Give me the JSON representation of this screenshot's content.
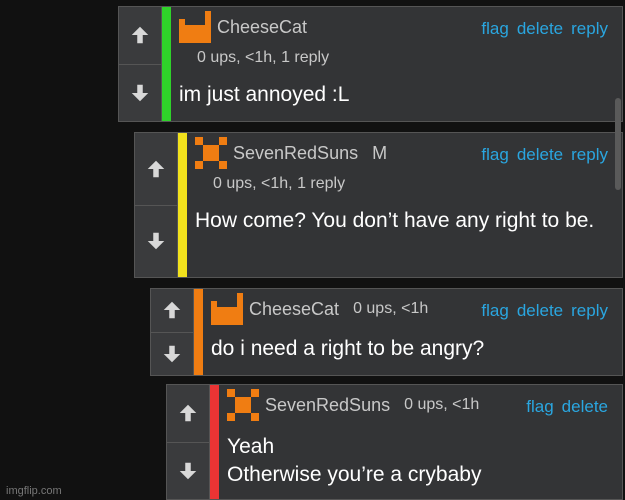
{
  "colors": {
    "green": "#2fd32a",
    "yellow": "#f2e21d",
    "orange": "#f07d12",
    "red": "#ea3434",
    "link": "#2aa6e0"
  },
  "comments": [
    {
      "username": "CheeseCat",
      "meta": "0 ups, <1h, 1 reply",
      "text": "im just annoyed :L",
      "actions": {
        "flag": "flag",
        "delete": "delete",
        "reply": "reply"
      }
    },
    {
      "username": "SevenRedSuns",
      "mod": "M",
      "meta": "0 ups, <1h, 1 reply",
      "text": "How come? You don’t have any right to be.",
      "actions": {
        "flag": "flag",
        "delete": "delete",
        "reply": "reply"
      }
    },
    {
      "username": "CheeseCat",
      "meta": "0 ups, <1h",
      "text": "do i need a right to be angry?",
      "actions": {
        "flag": "flag",
        "delete": "delete",
        "reply": "reply"
      }
    },
    {
      "username": "SevenRedSuns",
      "meta": "0 ups, <1h",
      "text_line1": "Yeah",
      "text_line2": "Otherwise you’re a crybaby",
      "actions": {
        "flag": "flag",
        "delete": "delete"
      }
    }
  ],
  "watermark": "imgflip.com"
}
